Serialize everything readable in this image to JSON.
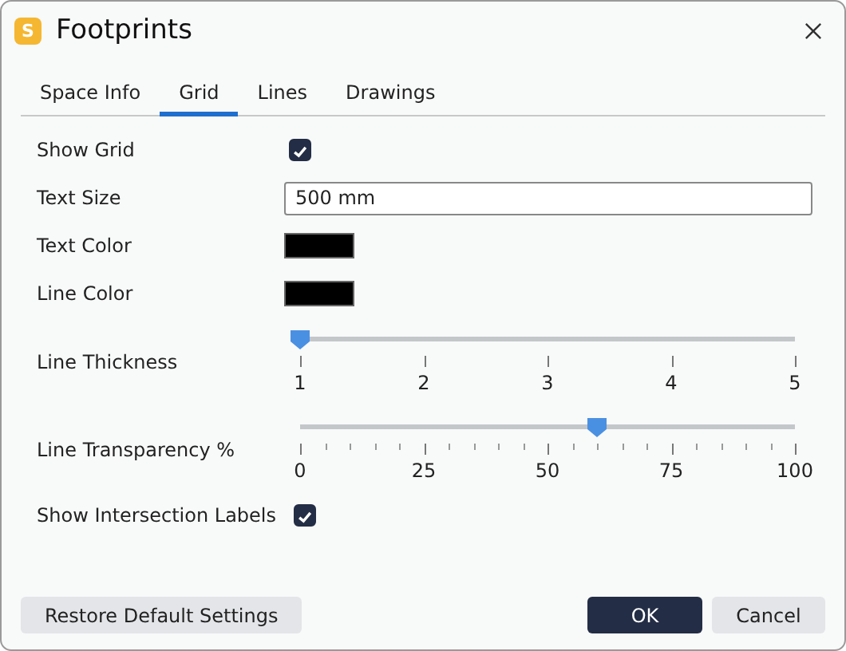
{
  "window": {
    "title": "Footprints",
    "app_badge": "S"
  },
  "tabs": [
    {
      "label": "Space Info",
      "selected": false
    },
    {
      "label": "Grid",
      "selected": true
    },
    {
      "label": "Lines",
      "selected": false
    },
    {
      "label": "Drawings",
      "selected": false
    }
  ],
  "settings": [
    {
      "kind": "checkbox",
      "label": "Show Grid",
      "checked": true
    },
    {
      "kind": "text",
      "label": "Text Size",
      "value": "500 mm"
    },
    {
      "kind": "color",
      "label": "Text Color",
      "color": "#000000"
    },
    {
      "kind": "color",
      "label": "Line Color",
      "color": "#000000"
    },
    {
      "kind": "slider",
      "label": "Line Thickness",
      "level": 0,
      "minor_ticks": false,
      "tick_labels": [
        "1",
        "2",
        "3",
        "4",
        "5"
      ]
    },
    {
      "kind": "slider",
      "label": "Line Transparency %",
      "level": 0.6,
      "minor_ticks": true,
      "tick_labels": [
        "0",
        "25",
        "50",
        "75",
        "100"
      ]
    },
    {
      "kind": "checkbox",
      "label": "Show Intersection Labels",
      "checked": true
    }
  ],
  "buttons": [
    {
      "label": "Restore Default Settings",
      "kind": "secondary"
    },
    {
      "label": "OK",
      "kind": "primary"
    },
    {
      "label": "Cancel",
      "kind": "secondary"
    }
  ]
}
